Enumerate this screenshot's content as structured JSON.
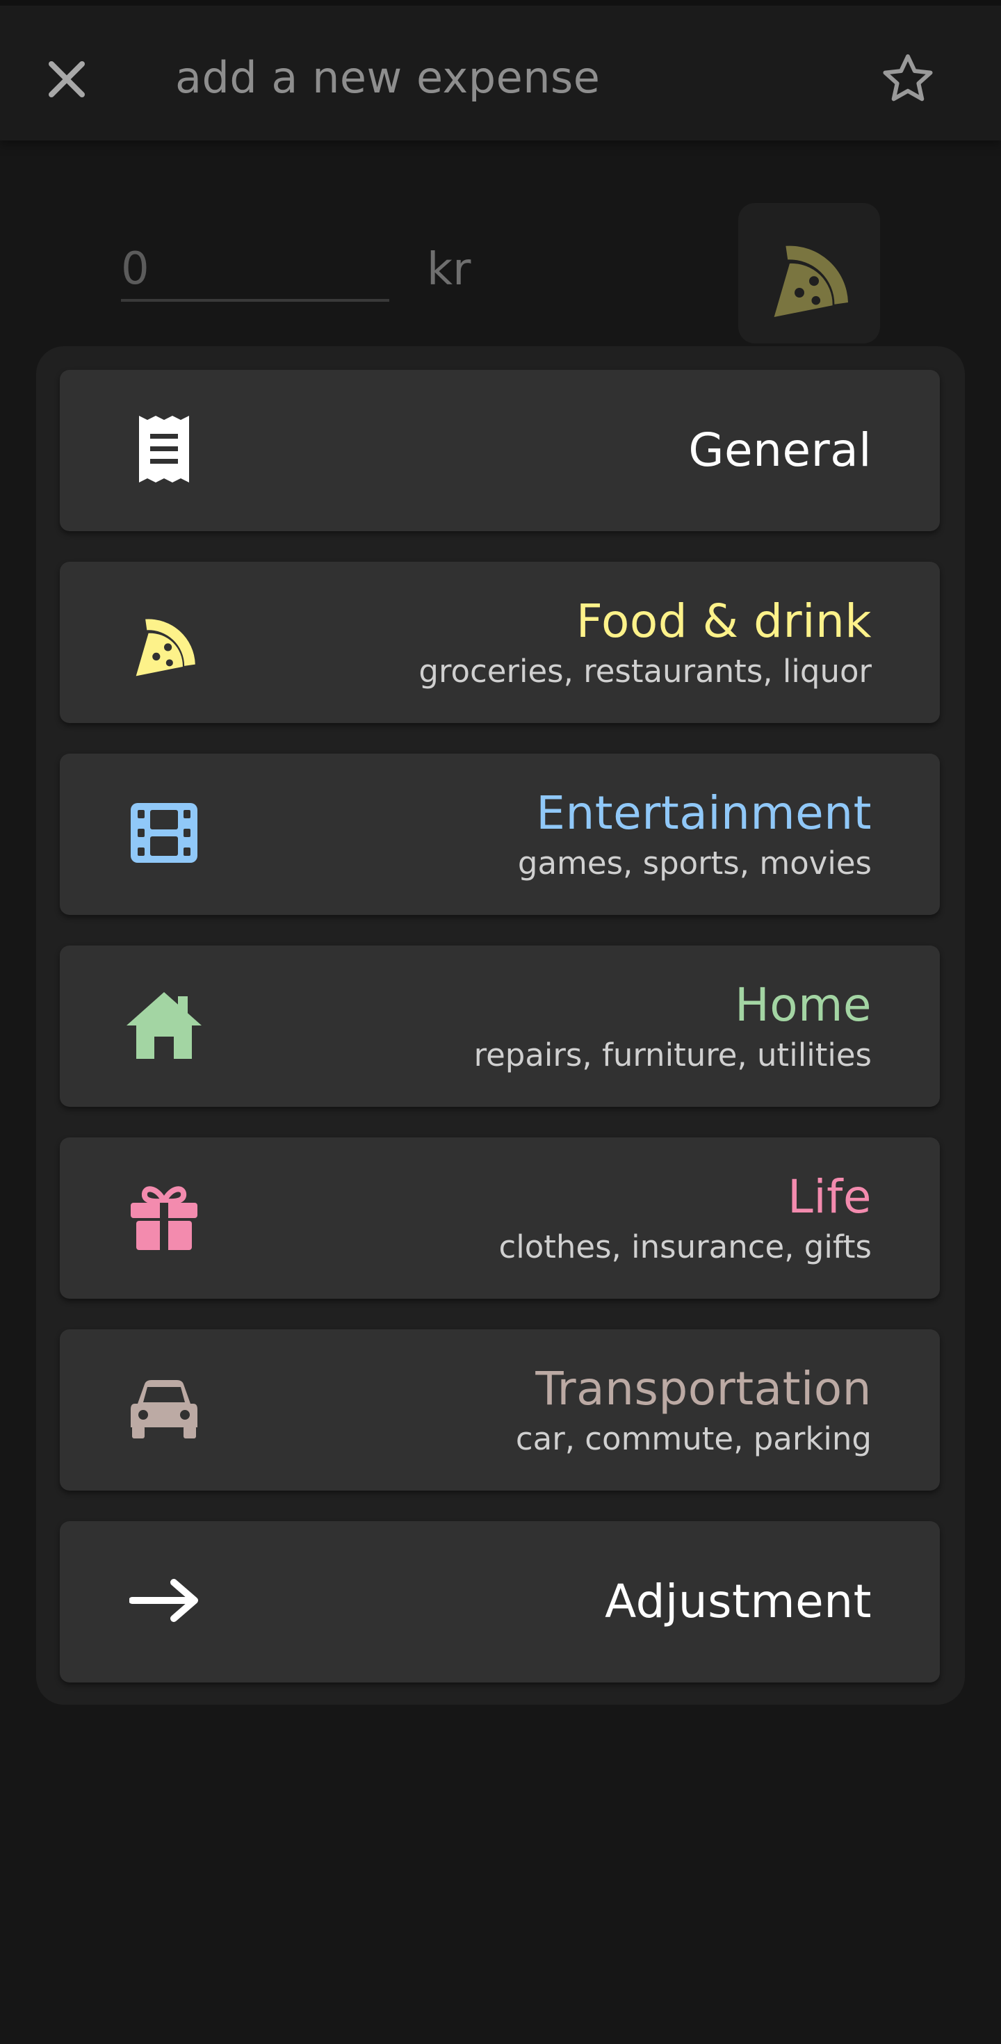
{
  "header": {
    "title": "add a new expense",
    "close_icon": "close-icon",
    "favorite_icon": "star-outline-icon"
  },
  "amount": {
    "placeholder": "0",
    "currency": "kr"
  },
  "selected_category": {
    "icon": "pizza-slice-icon",
    "color": "#7a7540"
  },
  "categories": [
    {
      "name": "General",
      "subtitle": "",
      "icon": "receipt-icon",
      "color": "#ffffff"
    },
    {
      "name": "Food & drink",
      "subtitle": "groceries, restaurants, liquor",
      "icon": "pizza-slice-icon",
      "color": "#fdf28a"
    },
    {
      "name": "Entertainment",
      "subtitle": "games, sports, movies",
      "icon": "film-icon",
      "color": "#90c8f8"
    },
    {
      "name": "Home",
      "subtitle": "repairs, furniture, utilities",
      "icon": "house-icon",
      "color": "#a3d5a3"
    },
    {
      "name": "Life",
      "subtitle": "clothes, insurance, gifts",
      "icon": "gift-icon",
      "color": "#f38bae"
    },
    {
      "name": "Transportation",
      "subtitle": "car, commute, parking",
      "icon": "car-icon",
      "color": "#bcaaa4"
    },
    {
      "name": "Adjustment",
      "subtitle": "",
      "icon": "arrow-right-icon",
      "color": "#ffffff"
    }
  ]
}
